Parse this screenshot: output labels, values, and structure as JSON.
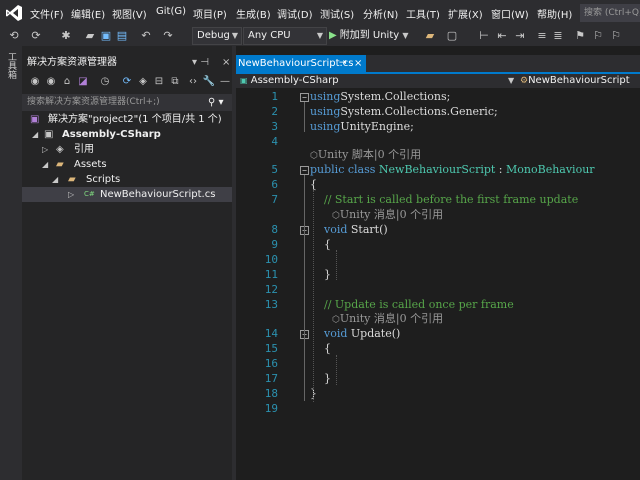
{
  "menu": [
    "文件(F)",
    "编辑(E)",
    "视图(V)",
    "Git(G)",
    "项目(P)",
    "生成(B)",
    "调试(D)",
    "测试(S)",
    "分析(N)",
    "工具(T)",
    "扩展(X)",
    "窗口(W)",
    "帮助(H)"
  ],
  "search": {
    "placeholder": "搜索 (Ctrl+Q)"
  },
  "toolbar": {
    "config": "Debug",
    "platform": "Any CPU",
    "run_label": "附加到 Unity"
  },
  "left_strip": {
    "label": "工具箱"
  },
  "solution_explorer": {
    "title": "解决方案资源管理器",
    "pin": "▾ ⊣",
    "search_placeholder": "搜索解决方案资源管理器(Ctrl+;)",
    "tree": [
      {
        "label": "解决方案\"project2\"(1 个项目/共 1 个)",
        "icon": "solution-icon",
        "level": 0,
        "arrow": ""
      },
      {
        "label": "Assembly-CSharp",
        "icon": "csharp-project-icon",
        "level": 1,
        "arrow": "▲",
        "bold": true
      },
      {
        "label": "引用",
        "icon": "references-icon",
        "level": 2,
        "arrow": "▶"
      },
      {
        "label": "Assets",
        "icon": "folder-icon",
        "level": 2,
        "arrow": "▲"
      },
      {
        "label": "Scripts",
        "icon": "folder-icon",
        "level": 3,
        "arrow": "▲"
      },
      {
        "label": "NewBehaviourScript.cs",
        "icon": "csharp-file-icon",
        "level": 4,
        "arrow": "▶",
        "selected": true
      }
    ]
  },
  "editor_tab": {
    "label": "NewBehaviourScript.cs",
    "pin": "⇥",
    "close": "×"
  },
  "nav": {
    "left": "Assembly-CSharp",
    "right": "NewBehaviourScript"
  },
  "lens": {
    "class_refs": "Unity 脚本|0 个引用",
    "start_refs": "Unity 消息|0 个引用",
    "update_refs": "Unity 消息|0 个引用"
  },
  "code_lines": [
    {
      "n": "1",
      "parts": [
        [
          "kw",
          "using"
        ],
        [
          "",
          "System.Collections;"
        ]
      ]
    },
    {
      "n": "2",
      "parts": [
        [
          "kw",
          "using"
        ],
        [
          "",
          "System.Collections.Generic;"
        ]
      ]
    },
    {
      "n": "3",
      "parts": [
        [
          "kw",
          "using"
        ],
        [
          "",
          "UnityEngine;"
        ]
      ]
    },
    {
      "n": "4",
      "parts": []
    },
    {
      "n": "5",
      "parts": [
        [
          "kw",
          "public class "
        ],
        [
          "ty",
          "NewBehaviourScript"
        ],
        [
          "",
          " : "
        ],
        [
          "ty",
          "MonoBehaviour"
        ]
      ]
    },
    {
      "n": "6",
      "parts": [
        [
          "",
          "{"
        ]
      ]
    },
    {
      "n": "7",
      "parts": [
        [
          "cm",
          "    // Start is called before the first frame update"
        ]
      ]
    },
    {
      "n": "8",
      "parts": [
        [
          "kw",
          "    void "
        ],
        [
          "",
          "Start()"
        ]
      ]
    },
    {
      "n": "9",
      "parts": [
        [
          "",
          "    {"
        ]
      ]
    },
    {
      "n": "10",
      "parts": []
    },
    {
      "n": "11",
      "parts": [
        [
          "",
          "    }"
        ]
      ]
    },
    {
      "n": "12",
      "parts": []
    },
    {
      "n": "13",
      "parts": [
        [
          "cm",
          "    // Update is called once per frame"
        ]
      ]
    },
    {
      "n": "14",
      "parts": [
        [
          "kw",
          "    void "
        ],
        [
          "",
          "Update()"
        ]
      ]
    },
    {
      "n": "15",
      "parts": [
        [
          "",
          "    {"
        ]
      ]
    },
    {
      "n": "16",
      "parts": []
    },
    {
      "n": "17",
      "parts": [
        [
          "",
          "    }"
        ]
      ]
    },
    {
      "n": "18",
      "parts": [
        [
          "",
          "}"
        ]
      ]
    },
    {
      "n": "19",
      "parts": []
    }
  ],
  "colors": {
    "accent": "#007acc",
    "chrome": "#2d2d30",
    "editor_bg": "#1e1e1e",
    "keyword": "#569cd6",
    "type": "#4ec9b0",
    "comment": "#57a64a",
    "line_number": "#2b91af"
  }
}
